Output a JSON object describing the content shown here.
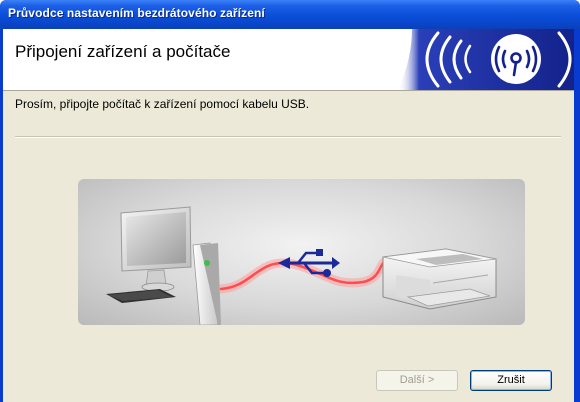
{
  "window": {
    "title": "Průvodce nastavením bezdrátového zařízení"
  },
  "header": {
    "title": "Připojení zařízení a počítače",
    "banner_icon": "wireless-signal-icon"
  },
  "main": {
    "instruction": "Prosím, připojte počítač k zařízení pomocí kabelu USB.",
    "illustration": {
      "computer_icon": "desktop-computer-icon",
      "usb_icon": "usb-symbol-icon",
      "printer_icon": "printer-icon"
    }
  },
  "buttons": {
    "next_label": "Další >",
    "next_enabled": false,
    "cancel_label": "Zrušit"
  },
  "colors": {
    "titlebar": "#0a4ed8",
    "client_bg": "#ece9d8",
    "banner_blue": "#1b2a9a",
    "cable_glow": "#ff6a6a"
  }
}
